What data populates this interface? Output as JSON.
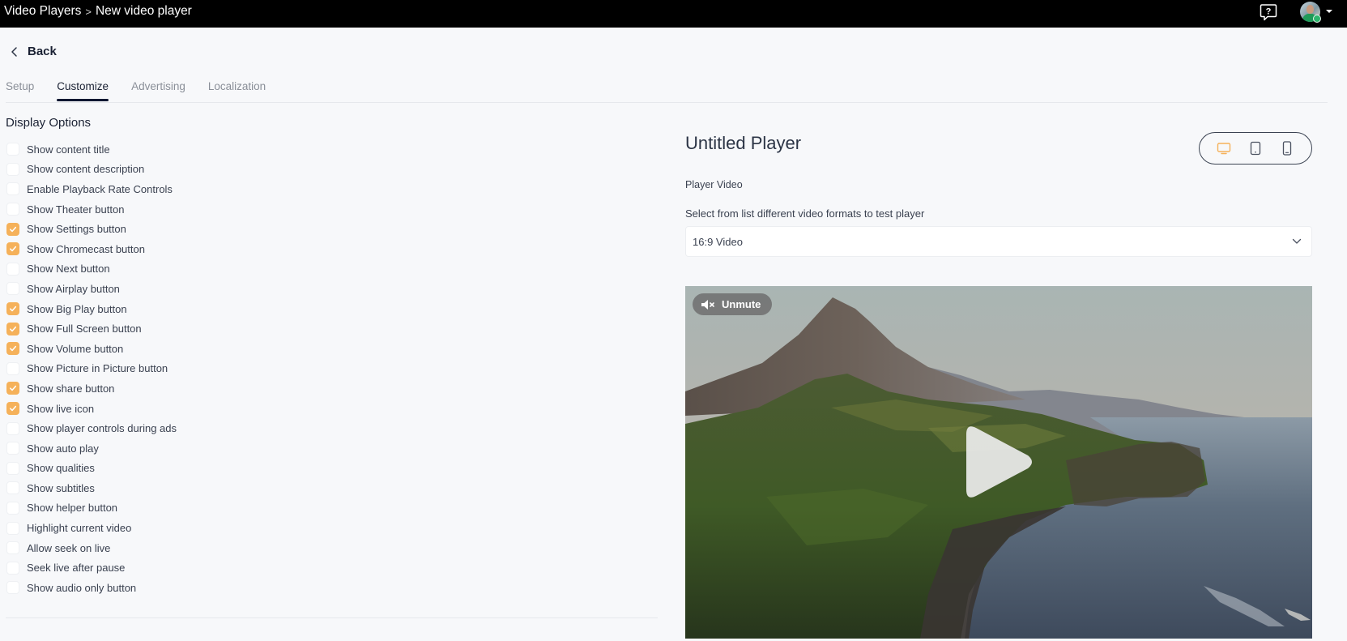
{
  "header": {
    "breadcrumb": [
      "Video Players",
      "New video player"
    ],
    "breadcrumb_separator": ">",
    "help_icon": "help-speech-bubble-icon",
    "user_status": "online"
  },
  "nav": {
    "back_label": "Back",
    "tabs": [
      {
        "label": "Setup",
        "active": false
      },
      {
        "label": "Customize",
        "active": true
      },
      {
        "label": "Advertising",
        "active": false
      },
      {
        "label": "Localization",
        "active": false
      }
    ]
  },
  "display_options": {
    "title": "Display Options",
    "items": [
      {
        "label": "Show content title",
        "checked": false
      },
      {
        "label": "Show content description",
        "checked": false
      },
      {
        "label": "Enable Playback Rate Controls",
        "checked": false
      },
      {
        "label": "Show Theater button",
        "checked": false
      },
      {
        "label": "Show Settings button",
        "checked": true
      },
      {
        "label": "Show Chromecast button",
        "checked": true
      },
      {
        "label": "Show Next button",
        "checked": false
      },
      {
        "label": "Show Airplay button",
        "checked": false
      },
      {
        "label": "Show Big Play button",
        "checked": true
      },
      {
        "label": "Show Full Screen button",
        "checked": true
      },
      {
        "label": "Show Volume button",
        "checked": true
      },
      {
        "label": "Show Picture in Picture button",
        "checked": false
      },
      {
        "label": "Show share button",
        "checked": true
      },
      {
        "label": "Show live icon",
        "checked": true
      },
      {
        "label": "Show player controls during ads",
        "checked": false
      },
      {
        "label": "Show auto play",
        "checked": false
      },
      {
        "label": "Show qualities",
        "checked": false
      },
      {
        "label": "Show subtitles",
        "checked": false
      },
      {
        "label": "Show helper button",
        "checked": false
      },
      {
        "label": "Highlight current video",
        "checked": false
      },
      {
        "label": "Allow seek on live",
        "checked": false
      },
      {
        "label": "Seek live after pause",
        "checked": false
      },
      {
        "label": "Show audio only button",
        "checked": false
      }
    ]
  },
  "preview": {
    "title": "Untitled Player",
    "device_toggle": {
      "options": [
        "desktop",
        "tablet",
        "mobile"
      ],
      "selected": "desktop"
    },
    "player_video_label": "Player Video",
    "select_help": "Select from list different video formats to test player",
    "select_value": "16:9 Video",
    "video": {
      "unmute_label": "Unmute",
      "big_play_visible": true
    }
  },
  "colors": {
    "accent": "#f5b15a",
    "header_bg": "#000000",
    "page_bg": "#f7f8fa",
    "active_tab_underline": "#0f1731",
    "online": "#2fb56d"
  }
}
